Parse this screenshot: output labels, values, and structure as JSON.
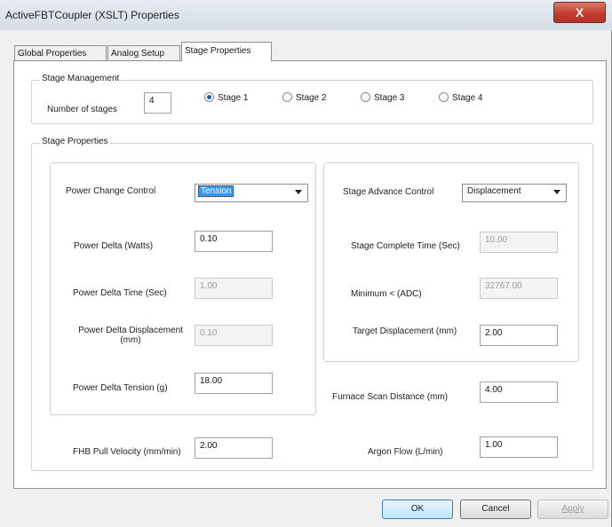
{
  "window": {
    "title": "ActiveFBTCoupler (XSLT) Properties",
    "close_glyph": "X"
  },
  "tabs": [
    {
      "label": "Global Properties"
    },
    {
      "label": "Analog Setup"
    },
    {
      "label": "Stage Properties"
    }
  ],
  "stage_management": {
    "legend": "Stage Management",
    "number_of_stages_label": "Number of stages",
    "number_of_stages_value": "4",
    "stages": [
      {
        "label": "Stage 1",
        "selected": true
      },
      {
        "label": "Stage 2",
        "selected": false
      },
      {
        "label": "Stage 3",
        "selected": false
      },
      {
        "label": "Stage 4",
        "selected": false
      }
    ]
  },
  "stage_properties": {
    "legend": "Stage Properties",
    "power_change_control_label": "Power Change Control",
    "power_change_control_value": "Tension",
    "power_delta_label": "Power Delta (Watts)",
    "power_delta_value": "0.10",
    "power_delta_time_label": "Power Delta Time (Sec)",
    "power_delta_time_value": "1.00",
    "power_delta_displacement_label_line1": "Power Delta Displacement",
    "power_delta_displacement_label_line2": "(mm)",
    "power_delta_displacement_value": "0.10",
    "power_delta_tension_label": "Power Delta Tension (g)",
    "power_delta_tension_value": "18.00",
    "stage_advance_control_label": "Stage Advance Control",
    "stage_advance_control_value": "Displacement",
    "stage_complete_time_label": "Stage Complete Time (Sec)",
    "stage_complete_time_value": "10.00",
    "minimum_adc_label": "Minimum < (ADC)",
    "minimum_adc_value": "32767.00",
    "target_displacement_label": "Target Displacement (mm)",
    "target_displacement_value": "2.00",
    "furnace_scan_distance_label": "Furnace Scan Distance (mm)",
    "furnace_scan_distance_value": "4.00",
    "fhb_pull_velocity_label": "FHB Pull Velocity (mm/min)",
    "fhb_pull_velocity_value": "2.00",
    "argon_flow_label": "Argon Flow (L/min)",
    "argon_flow_value": "1.00"
  },
  "buttons": {
    "ok": "OK",
    "cancel": "Cancel",
    "apply": "Apply"
  }
}
